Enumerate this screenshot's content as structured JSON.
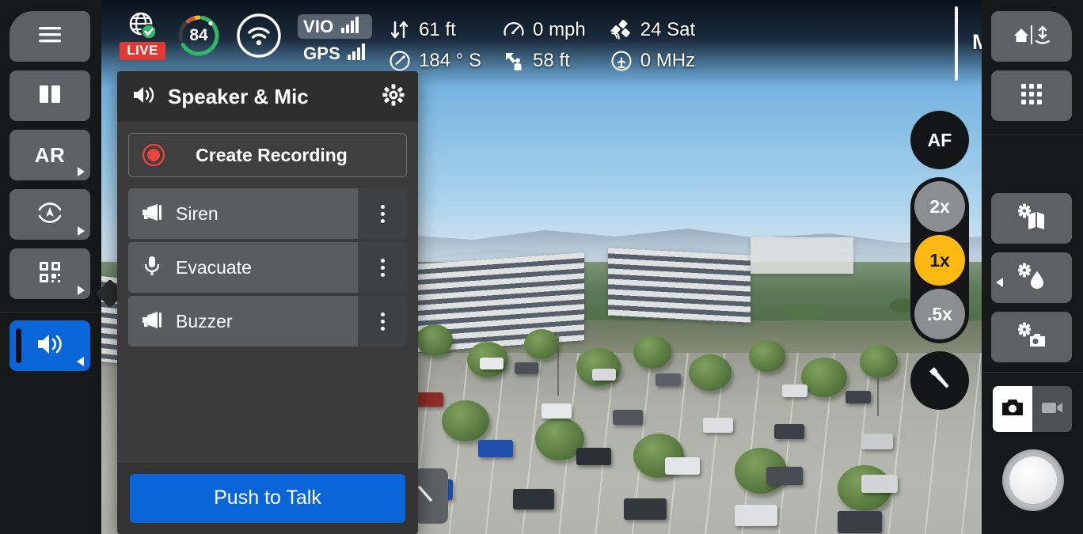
{
  "status_bar": {
    "live_badge": "LIVE",
    "globe_icon": "globe-check-icon",
    "battery_percent": "84",
    "wifi_icon": "wifi-icon",
    "signals": [
      {
        "label": "VIO",
        "icon": "signal-bars-icon",
        "active": true
      },
      {
        "label": "GPS",
        "icon": "signal-bars-icon",
        "active": false
      }
    ],
    "telemetry": [
      {
        "icon": "altitude-updown-icon",
        "value": "61 ft"
      },
      {
        "icon": "compass-icon",
        "value": "184 ° S"
      },
      {
        "icon": "speedometer-icon",
        "value": "0 mph"
      },
      {
        "icon": "distance-to-pilot-icon",
        "value": "58 ft"
      },
      {
        "icon": "satellite-icon",
        "value": "24 Sat"
      },
      {
        "icon": "radio-tower-icon",
        "value": "0 MHz"
      }
    ],
    "flight_mode": "Manual"
  },
  "sidebar": {
    "items": [
      {
        "name": "menu-button",
        "icon": "hamburger-icon",
        "label": "",
        "active": false,
        "caret": "none"
      },
      {
        "name": "split-view-button",
        "icon": "split-panel-icon",
        "label": "",
        "active": false,
        "caret": "none"
      },
      {
        "name": "ar-button",
        "icon": "",
        "label": "AR",
        "active": false,
        "caret": "right"
      },
      {
        "name": "gimbal-button",
        "icon": "gimbal-heading-icon",
        "label": "",
        "active": false,
        "caret": "right"
      },
      {
        "name": "scan-button",
        "icon": "qr-grid-icon",
        "label": "",
        "active": false,
        "caret": "right"
      },
      {
        "name": "speaker-button",
        "icon": "speaker-icon",
        "label": "",
        "active": true,
        "caret": "left"
      }
    ]
  },
  "panel": {
    "title": "Speaker & Mic",
    "title_icon": "speaker-icon",
    "settings_icon": "gear-icon",
    "record_button": {
      "label": "Create Recording",
      "icon": "record-dot-icon"
    },
    "clips": [
      {
        "label": "Siren",
        "icon": "megaphone-icon",
        "menu_icon": "kebab-menu-icon"
      },
      {
        "label": "Evacuate",
        "icon": "microphone-icon",
        "menu_icon": "kebab-menu-icon"
      },
      {
        "label": "Buzzer",
        "icon": "megaphone-icon",
        "menu_icon": "kebab-menu-icon"
      }
    ],
    "push_to_talk": "Push to Talk"
  },
  "camera_rail": {
    "autofocus": "AF",
    "zoom_levels": [
      {
        "label": "2x",
        "selected": false
      },
      {
        "label": "1x",
        "selected": true
      },
      {
        "label": ".5x",
        "selected": false
      }
    ],
    "flashlight_icon": "flashlight-icon"
  },
  "right_panel": {
    "top_buttons": [
      {
        "name": "home-land-button",
        "icon": "home-land-icon"
      },
      {
        "name": "app-grid-button",
        "icon": "grid-dots-icon"
      }
    ],
    "settings_buttons": [
      {
        "name": "map-settings-button",
        "icon": "gear-map-icon"
      },
      {
        "name": "thermal-settings-button",
        "icon": "gear-thermal-icon",
        "caret": "left"
      },
      {
        "name": "camera-settings-button",
        "icon": "gear-camera-icon"
      }
    ],
    "capture_mode": [
      {
        "name": "photo-mode",
        "icon": "camera-icon",
        "selected": true
      },
      {
        "name": "video-mode",
        "icon": "video-camera-icon",
        "selected": false
      }
    ],
    "shutter_button": "shutter-button"
  },
  "colors": {
    "accent_blue": "#0a66d8",
    "zoom_selected": "#fdb913",
    "live_red": "#e03b32",
    "battery_green": "#2fb866",
    "panel_bg": "#3b3b3b",
    "chrome_bg": "#17181a"
  }
}
